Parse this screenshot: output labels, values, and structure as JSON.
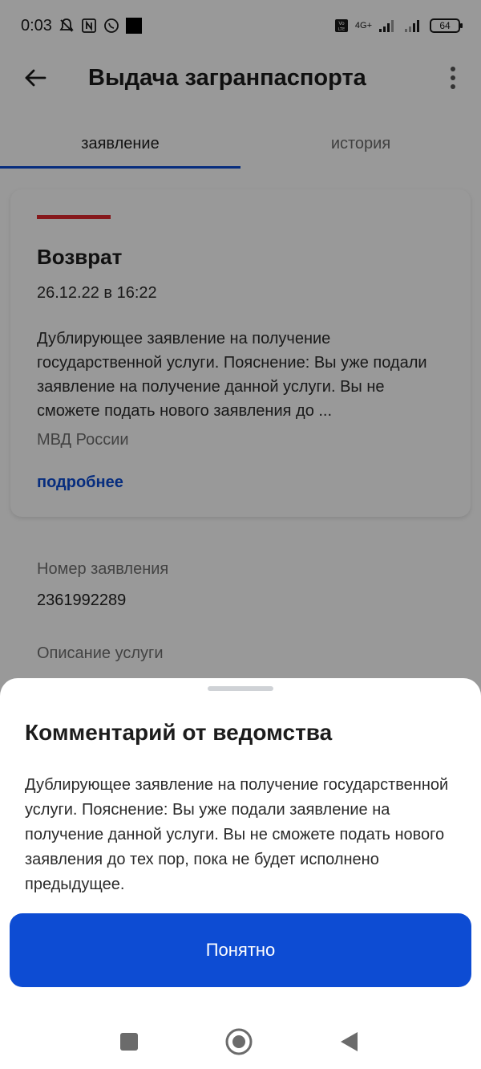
{
  "status_bar": {
    "time": "0:03",
    "network": "4G+",
    "battery": "64"
  },
  "header": {
    "title": "Выдача загранпаспорта"
  },
  "tabs": [
    {
      "label": "заявление"
    },
    {
      "label": "история"
    }
  ],
  "card": {
    "status": "Возврат",
    "date": "26.12.22 в 16:22",
    "description": "Дублирующее заявление на получение государственной услуги. Пояснение: Вы уже подали заявление на получение данной услуги. Вы не сможете подать нового заявления до ...",
    "agency": "МВД России",
    "more_link": "подробнее",
    "stripe_color": "#e0292d"
  },
  "fields": {
    "number_label": "Номер заявления",
    "number_value": "2361992289",
    "service_label": "Описание услуги"
  },
  "sheet": {
    "title": "Комментарий от ведомства",
    "text": "Дублирующее заявление на получение государственной услуги. Пояснение: Вы уже подали заявление на получение данной услуги. Вы не сможете подать нового заявления до тех пор, пока не будет исполнено предыдущее.",
    "button_label": "Понятно"
  },
  "colors": {
    "accent": "#0d4cd3",
    "status_red": "#e0292d"
  },
  "nav_icons": [
    "recent-apps-icon",
    "home-icon",
    "back-nav-icon"
  ]
}
